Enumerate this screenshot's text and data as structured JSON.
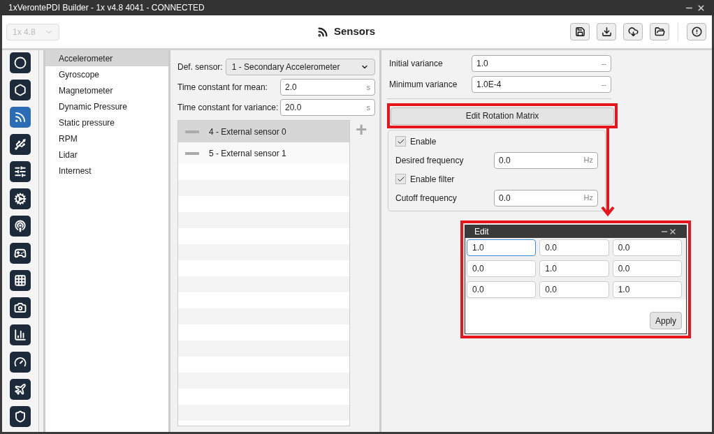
{
  "window": {
    "title": "1xVerontePDI Builder - 1x v4.8 4041 - CONNECTED"
  },
  "header": {
    "version_select": "1x 4.8",
    "title": "Sensors"
  },
  "toolbar": [
    {
      "kind": "save"
    },
    {
      "kind": "download"
    },
    {
      "kind": "cloud"
    },
    {
      "kind": "folder"
    },
    {
      "kind": "alert"
    }
  ],
  "icon_bar": [
    {
      "kind": "ring",
      "selected": false
    },
    {
      "kind": "hexagon",
      "selected": false
    },
    {
      "kind": "rss",
      "selected": true
    },
    {
      "kind": "usb",
      "selected": false
    },
    {
      "kind": "sliders",
      "selected": false
    },
    {
      "kind": "gears",
      "selected": false
    },
    {
      "kind": "podcast",
      "selected": false
    },
    {
      "kind": "gamepad",
      "selected": false
    },
    {
      "kind": "grid",
      "selected": false
    },
    {
      "kind": "camera",
      "selected": false
    },
    {
      "kind": "chart",
      "selected": false
    },
    {
      "kind": "gauge",
      "selected": false
    },
    {
      "kind": "plane",
      "selected": false
    },
    {
      "kind": "shield",
      "selected": false
    }
  ],
  "sensor_list": [
    {
      "label": "Accelerometer",
      "selected": true
    },
    {
      "label": "Gyroscope",
      "selected": false
    },
    {
      "label": "Magnetometer",
      "selected": false
    },
    {
      "label": "Dynamic Pressure",
      "selected": false
    },
    {
      "label": "Static pressure",
      "selected": false
    },
    {
      "label": "RPM",
      "selected": false
    },
    {
      "label": "Lidar",
      "selected": false
    },
    {
      "label": "Internest",
      "selected": false
    }
  ],
  "config": {
    "def_sensor": {
      "label": "Def. sensor:",
      "value": "1 - Secondary Accelerometer"
    },
    "fields": [
      {
        "label": "Time constant for mean:",
        "value": "2.0",
        "unit": "s"
      },
      {
        "label": "Time constant for variance:",
        "value": "20.0",
        "unit": "s"
      }
    ],
    "sources": [
      {
        "label": "4 - External sensor 0",
        "selected": true
      },
      {
        "label": "5 - External sensor 1",
        "selected": false
      }
    ],
    "add_button": "+"
  },
  "variance": [
    {
      "label": "Initial variance",
      "value": "1.0",
      "unit": "--"
    },
    {
      "label": "Minimum variance",
      "value": "1.0E-4",
      "unit": "--"
    }
  ],
  "edit_button": "Edit Rotation Matrix",
  "filter_group": [
    {
      "kind": "check",
      "label": "Enable",
      "checked": true
    },
    {
      "kind": "field",
      "label": "Desired frequency",
      "value": "0.0",
      "unit": "Hz"
    },
    {
      "kind": "check",
      "label": "Enable filter",
      "checked": true
    },
    {
      "kind": "field",
      "label": "Cutoff frequency",
      "value": "0.0",
      "unit": "Hz"
    }
  ],
  "edit_dialog": {
    "title": "Edit",
    "matrix": [
      [
        "1.0",
        "0.0",
        "0.0"
      ],
      [
        "0.0",
        "1.0",
        "0.0"
      ],
      [
        "0.0",
        "0.0",
        "1.0"
      ]
    ],
    "apply": "Apply"
  }
}
